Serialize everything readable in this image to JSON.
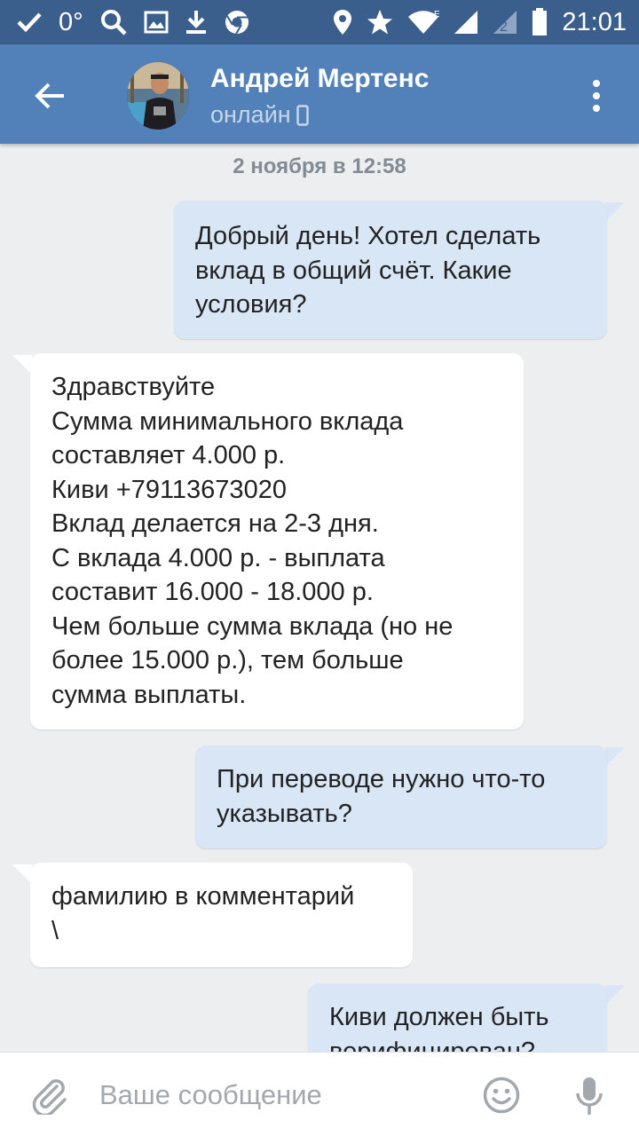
{
  "status_bar": {
    "left_text": "0°",
    "time": "21:01",
    "icons_left": [
      "check-icon",
      "search-icon",
      "image-icon",
      "download-icon",
      "chrome-icon"
    ],
    "icons_right": [
      "location-icon",
      "star-icon",
      "wifi-icon",
      "signal-icon",
      "signal-2-icon",
      "battery-icon"
    ]
  },
  "header": {
    "contact_name": "Андрей Мертенс",
    "status": "онлайн",
    "icons": [
      "back-arrow-icon",
      "avatar",
      "phone-icon",
      "more-vert-icon"
    ]
  },
  "chat": {
    "date": "2 ноября в 12:58",
    "messages": [
      {
        "direction": "out",
        "text": "Добрый день! Хотел сделать\nвклад в общий счёт. Какие\nусловия?"
      },
      {
        "direction": "in",
        "text": "Здравствуйте\nСумма минимального вклада\nсоставляет 4.000 р.\nКиви +79113673020\nВклад делается на 2-3 дня.\nС вклада 4.000 р. - выплата\nсоставит 16.000 - 18.000 р.\nЧем больше сумма вклада (но не\nболее 15.000 р.), тем больше\nсумма выплаты."
      },
      {
        "direction": "out",
        "text": "При переводе нужно что-то\nуказывать?"
      },
      {
        "direction": "in",
        "text": "фамилию в комментарий\n\\"
      },
      {
        "direction": "out",
        "text": "Киви должен быть\nверифицирован?"
      }
    ]
  },
  "input_bar": {
    "placeholder": "Ваше сообщение",
    "value": "",
    "icons": [
      "paperclip-icon",
      "emoji-icon",
      "mic-icon"
    ]
  },
  "colors": {
    "status_bar": "#3a5f8d",
    "header": "#5181b8",
    "background": "#edeef0",
    "outgoing_bubble": "#d8e6f5",
    "incoming_bubble": "#ffffff",
    "date_text": "#838b94"
  }
}
